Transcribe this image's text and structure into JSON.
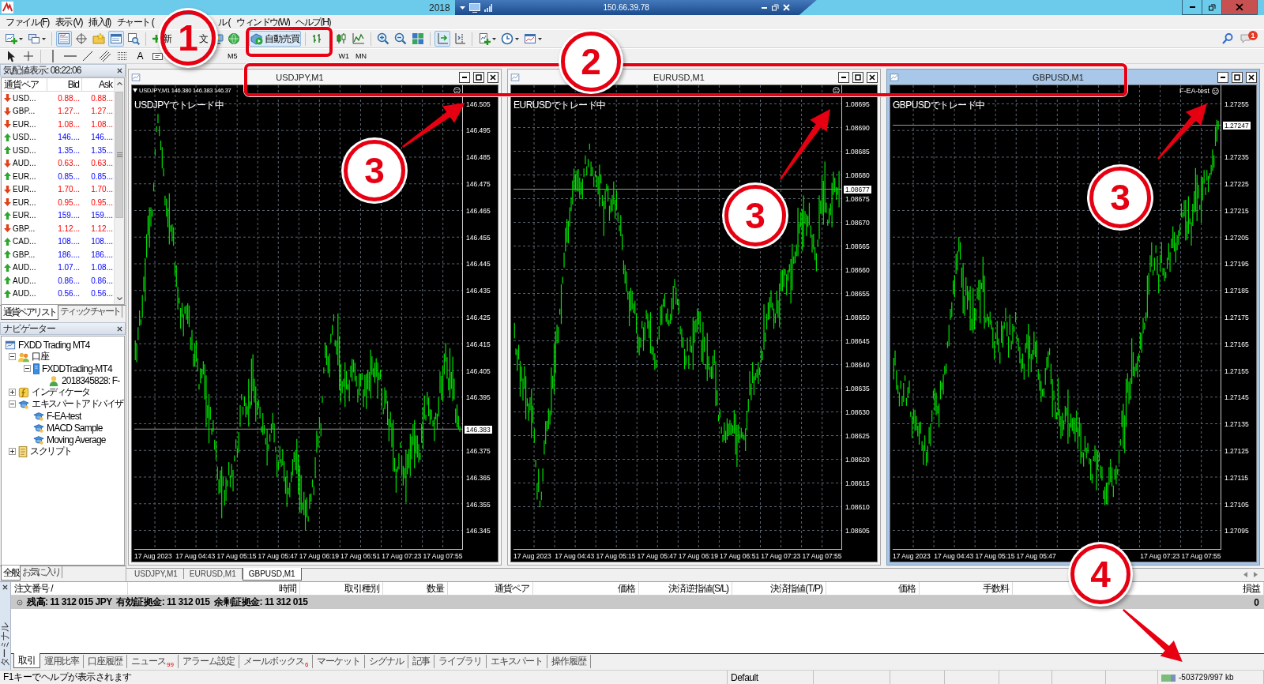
{
  "window": {
    "title": "2018",
    "remote_address": "150.66.39.78"
  },
  "menu": [
    "ファイル (F)",
    "表示 (V)",
    "挿入(I)",
    "チャート (",
    "ル (",
    "ウィンドウ(W)",
    "ヘルプ(H)"
  ],
  "toolbar": {
    "new_order": [
      "新",
      "文"
    ],
    "auto_trading": {
      "label": "自動売買",
      "on": true
    },
    "toggles": {
      "market_watch": true,
      "terminal": true,
      "auto_scroll": true
    },
    "text_tool": "A",
    "timeframes": [
      "M5"
    ],
    "timeframes_right": [
      "W1",
      "MN"
    ],
    "notifications": "1"
  },
  "market_watch": {
    "title": "気配値表示: 08:22:06",
    "columns": [
      "通貨ペア",
      "Bid",
      "Ask"
    ],
    "rows": [
      {
        "symbol": "USD...",
        "bid": "0.88...",
        "ask": "0.88...",
        "kind": "down"
      },
      {
        "symbol": "GBP...",
        "bid": "1.27...",
        "ask": "1.27...",
        "kind": "down"
      },
      {
        "symbol": "EUR...",
        "bid": "1.08...",
        "ask": "1.08...",
        "kind": "down"
      },
      {
        "symbol": "USD...",
        "bid": "146....",
        "ask": "146....",
        "kind": "up"
      },
      {
        "symbol": "USD...",
        "bid": "1.35...",
        "ask": "1.35...",
        "kind": "up"
      },
      {
        "symbol": "AUD...",
        "bid": "0.63...",
        "ask": "0.63...",
        "kind": "down"
      },
      {
        "symbol": "EUR...",
        "bid": "0.85...",
        "ask": "0.85...",
        "kind": "up"
      },
      {
        "symbol": "EUR...",
        "bid": "1.70...",
        "ask": "1.70...",
        "kind": "down"
      },
      {
        "symbol": "EUR...",
        "bid": "0.95...",
        "ask": "0.95...",
        "kind": "down"
      },
      {
        "symbol": "EUR...",
        "bid": "159....",
        "ask": "159....",
        "kind": "up"
      },
      {
        "symbol": "GBP...",
        "bid": "1.12...",
        "ask": "1.12...",
        "kind": "down"
      },
      {
        "symbol": "CAD...",
        "bid": "108....",
        "ask": "108....",
        "kind": "up"
      },
      {
        "symbol": "GBP...",
        "bid": "186....",
        "ask": "186....",
        "kind": "up"
      },
      {
        "symbol": "AUD...",
        "bid": "1.07...",
        "ask": "1.08...",
        "kind": "up"
      },
      {
        "symbol": "AUD...",
        "bid": "0.86...",
        "ask": "0.86...",
        "kind": "up"
      },
      {
        "symbol": "AUD...",
        "bid": "0.56...",
        "ask": "0.56...",
        "kind": "up"
      }
    ],
    "tabs": [
      {
        "label": "通貨ペアリスト",
        "selected": true
      },
      {
        "label": "ティックチャート",
        "selected": false
      }
    ]
  },
  "navigator": {
    "title": "ナビゲーター",
    "tree": [
      {
        "kind": "terminal",
        "label": "FXDD Trading MT4",
        "children": [
          {
            "kind": "accounts",
            "label": "口座",
            "expanded": true,
            "children": [
              {
                "kind": "server",
                "label": "FXDDTrading-MT4",
                "expanded": true,
                "children": [
                  {
                    "kind": "account",
                    "label": "2018345828: F-"
                  }
                ]
              }
            ]
          },
          {
            "kind": "indicators",
            "label": "インディケータ",
            "expanded": false
          },
          {
            "kind": "experts",
            "label": "エキスパートアドバイザ",
            "expanded": true,
            "children": [
              {
                "kind": "expert",
                "label": "F-EA-test"
              },
              {
                "kind": "expert",
                "label": "MACD Sample"
              },
              {
                "kind": "expert",
                "label": "Moving Average"
              }
            ]
          },
          {
            "kind": "scripts",
            "label": "スクリプト",
            "expanded": false
          }
        ]
      }
    ],
    "tabs": [
      {
        "label": "全般",
        "selected": true
      },
      {
        "label": "お気に入り",
        "selected": false
      }
    ]
  },
  "charts": [
    {
      "title": "USDJPY,M1",
      "active": false,
      "info": "USDJPY,M1 146.380 146.383 146.37",
      "status": "USDJPYでトレード中",
      "ea_running": true,
      "price_labels": [
        "146.505",
        "146.495",
        "146.485",
        "146.475",
        "146.465",
        "146.455",
        "146.445",
        "146.435",
        "146.425",
        "146.415",
        "146.405",
        "146.395",
        "146.375",
        "146.365",
        "146.355",
        "146.345"
      ],
      "current_price": "146.383",
      "time_labels": [
        "17 Aug 2023",
        "17 Aug 04:43",
        "17 Aug 05:15",
        "17 Aug 05:47",
        "17 Aug 06:19",
        "17 Aug 06:51",
        "17 Aug 07:23",
        "17 Aug 07:55"
      ]
    },
    {
      "title": "EURUSD,M1",
      "active": false,
      "status": "EURUSDでトレード中",
      "ea_running": true,
      "price_labels": [
        "1.08695",
        "1.08690",
        "1.08685",
        "1.08680",
        "1.08675",
        "1.08670",
        "1.08665",
        "1.08660",
        "1.08655",
        "1.08650",
        "1.08645",
        "1.08640",
        "1.08635",
        "1.08630",
        "1.08625",
        "1.08620",
        "1.08615",
        "1.08610",
        "1.08605"
      ],
      "current_price": "1.08677",
      "time_labels": [
        "17 Aug 2023",
        "17 Aug 04:43",
        "17 Aug 05:15",
        "17 Aug 05:47",
        "17 Aug 06:19",
        "17 Aug 06:51",
        "17 Aug 07:23",
        "17 Aug 07:55"
      ]
    },
    {
      "title": "GBPUSD,M1",
      "active": true,
      "status": "GBPUSDでトレード中",
      "expert": "F-EA-test",
      "ea_running": true,
      "price_labels": [
        "1.27255",
        "1.27235",
        "1.27225",
        "1.27215",
        "1.27205",
        "1.27195",
        "1.27185",
        "1.27175",
        "1.27165",
        "1.27155",
        "1.27145",
        "1.27135",
        "1.27125",
        "1.27115",
        "1.27105",
        "1.27095"
      ],
      "current_price": "1.27247",
      "time_labels": [
        "17 Aug 2023",
        "17 Aug 04:43",
        "17 Aug 05:15",
        "17 Aug 05:47",
        "17 Aug 07:23",
        "17 Aug 07:55"
      ]
    }
  ],
  "chart_tabs": [
    {
      "label": "USDJPY,M1",
      "selected": false
    },
    {
      "label": "EURUSD,M1",
      "selected": false
    },
    {
      "label": "GBPUSD,M1",
      "selected": true
    }
  ],
  "terminal": {
    "title": "ターミナル",
    "columns": [
      "注文番号 /",
      "時間",
      "取引種別",
      "数量",
      "通貨ペア",
      "価格",
      "決済逆指値(S/L)",
      "決済指値(T/P)",
      "価格",
      "手数料",
      "損益"
    ],
    "summary": "残高: 11 312 015 JPY  有効証拠金: 11 312 015  余剰証拠金: 11 312 015",
    "summary_profit": "0",
    "tabs": [
      {
        "label": "取引",
        "selected": true
      },
      {
        "label": "運用比率",
        "selected": false
      },
      {
        "label": "口座履歴",
        "selected": false
      },
      {
        "label": "ニュース",
        "badge": "99",
        "selected": false
      },
      {
        "label": "アラーム設定",
        "selected": false
      },
      {
        "label": "メールボックス",
        "badge": "6",
        "selected": false
      },
      {
        "label": "マーケット",
        "selected": false
      },
      {
        "label": "シグナル",
        "selected": false
      },
      {
        "label": "記事",
        "selected": false
      },
      {
        "label": "ライブラリ",
        "selected": false
      },
      {
        "label": "エキスパート",
        "selected": false
      },
      {
        "label": "操作履歴",
        "selected": false
      }
    ]
  },
  "status_bar": {
    "help": "F1キーでヘルプが表示されます",
    "profile": "Default",
    "traffic": "-503729/997 kb"
  },
  "annotations": {
    "callouts": [
      {
        "label": "1",
        "filled": false
      },
      {
        "label": "2",
        "filled": true
      },
      {
        "label": "3",
        "filled": true
      },
      {
        "label": "3",
        "filled": true
      },
      {
        "label": "3",
        "filled": true
      },
      {
        "label": "4",
        "filled": true
      }
    ]
  }
}
